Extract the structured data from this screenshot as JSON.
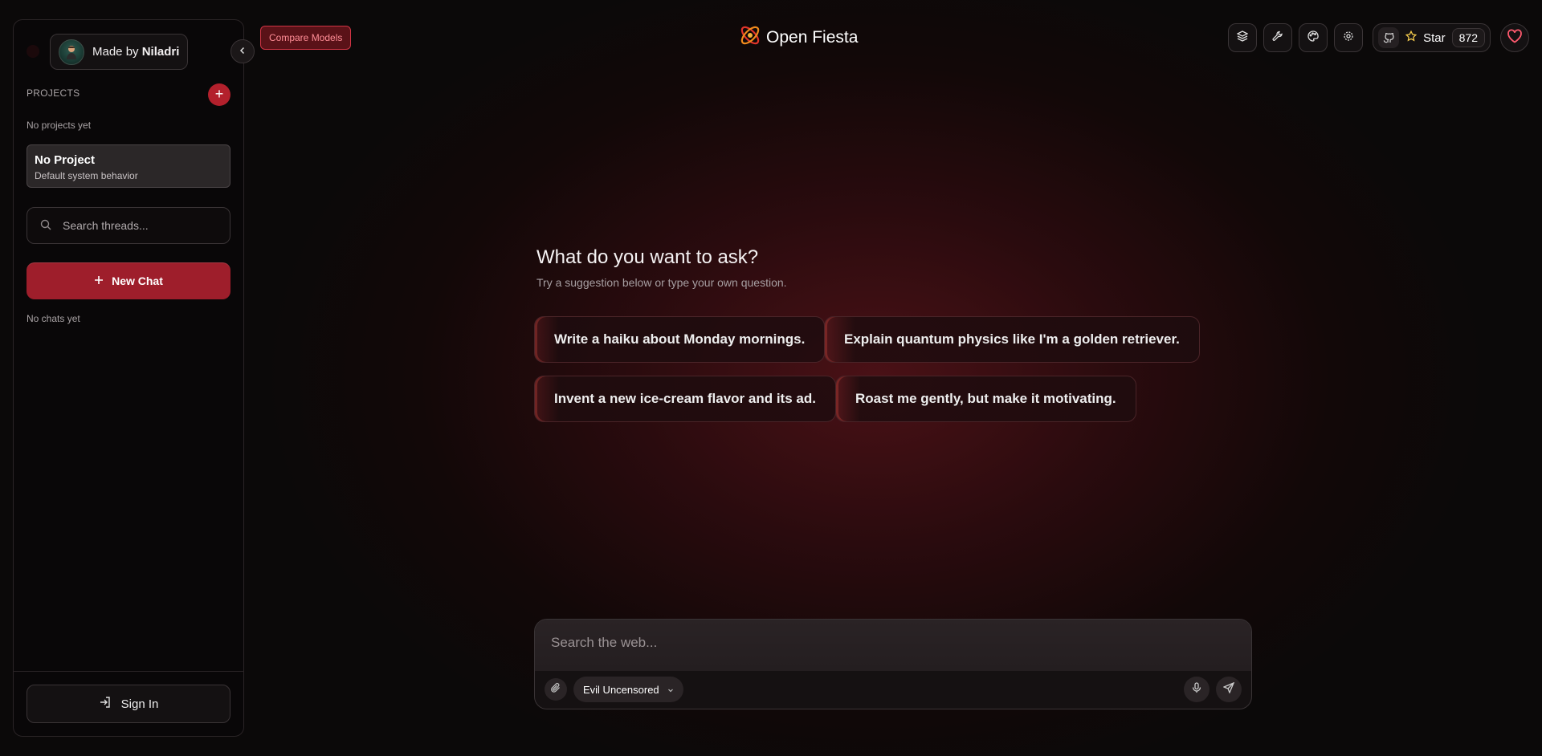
{
  "sidebar": {
    "author_prefix": "Made by",
    "author_name": "Niladri",
    "projects_label": "PROJECTS",
    "add_project": "+",
    "no_projects": "No projects yet",
    "project_card": {
      "title": "No Project",
      "subtitle": "Default system behavior"
    },
    "search_placeholder": "Search threads...",
    "new_chat": "New Chat",
    "no_chats": "No chats yet",
    "sign_in": "Sign In"
  },
  "header": {
    "compare_models": "Compare Models",
    "app_title": "Open Fiesta",
    "github_star_label": "Star",
    "github_star_count": "872",
    "icons": [
      "layers-icon",
      "wrench-icon",
      "palette-icon",
      "settings-icon",
      "github-icon",
      "star-icon",
      "heart-icon"
    ]
  },
  "main": {
    "headline": "What do you want to ask?",
    "subhead": "Try a suggestion below or type your own question.",
    "suggestions": [
      "Write a haiku about Monday mornings.",
      "Explain quantum physics like I'm a golden retriever.",
      "Invent a new ice-cream flavor and its ad.",
      "Roast me gently, but make it motivating."
    ]
  },
  "composer": {
    "placeholder": "Search the web...",
    "model": "Evil Uncensored"
  },
  "colors": {
    "accent": "#9e1e2b",
    "status_dot": "#e51b2a",
    "background": "#0b0909"
  }
}
